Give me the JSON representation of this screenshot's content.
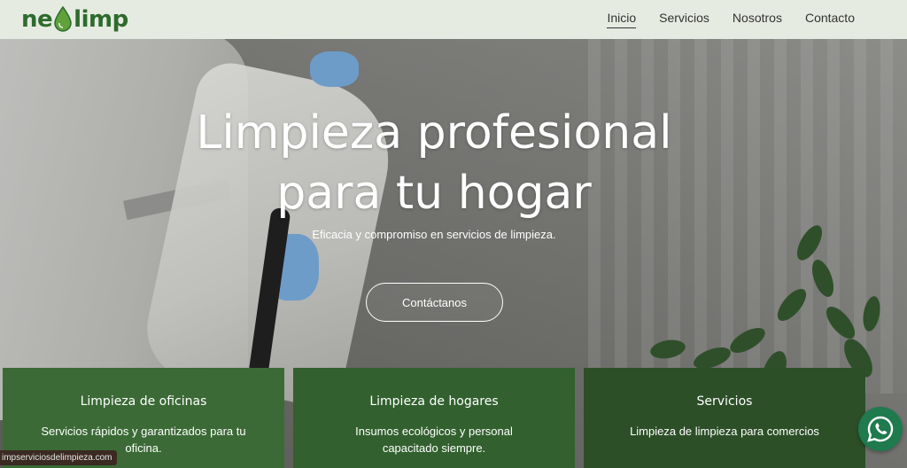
{
  "logo": {
    "text_left": "ne",
    "text_right": "limp",
    "brand_color": "#2e6b2e"
  },
  "nav": {
    "items": [
      {
        "label": "Inicio",
        "active": true
      },
      {
        "label": "Servicios",
        "active": false
      },
      {
        "label": "Nosotros",
        "active": false
      },
      {
        "label": "Contacto",
        "active": false
      }
    ]
  },
  "hero": {
    "title_line1": "Limpieza profesional",
    "title_line2": "para tu hogar",
    "subtitle": "Eficacia y compromiso en servicios de limpieza.",
    "cta_label": "Contáctanos"
  },
  "cards": [
    {
      "title": "Limpieza de oficinas",
      "text": "Servicios rápidos y garantizados para tu oficina.",
      "color": "#3b6a36"
    },
    {
      "title": "Limpieza de hogares",
      "text": "Insumos ecológicos y personal capacitado siempre.",
      "color": "#32602f"
    },
    {
      "title": "Servicios",
      "text": "Limpieza de limpieza para comercios",
      "color": "#2c4f27"
    }
  ],
  "status_url": "impserviciosdelimpieza.com",
  "whatsapp": {
    "icon": "whatsapp-icon",
    "color": "#1f7a4d"
  }
}
